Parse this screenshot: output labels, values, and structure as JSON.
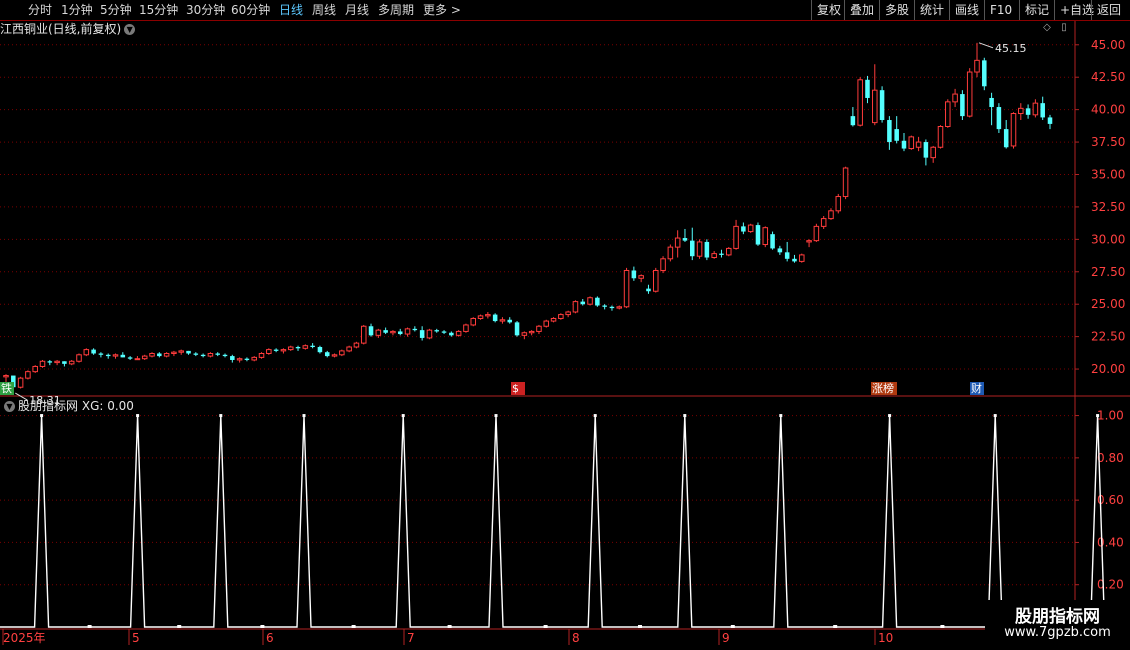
{
  "toolbar": {
    "periods": [
      "分时",
      "1分钟",
      "5分钟",
      "15分钟",
      "30分钟",
      "60分钟",
      "日线",
      "周线",
      "月线",
      "多周期",
      "更多 >"
    ],
    "active_period": "日线",
    "right_buttons": [
      "复权",
      "叠加",
      "多股",
      "统计",
      "画线",
      "F10",
      "标记",
      "+自选",
      "返回"
    ]
  },
  "header": {
    "title": "江西铜业(日线,前复权)"
  },
  "indicator": {
    "title": "股朋指标网",
    "label": "XG: 0.00"
  },
  "watermark": {
    "title": "股朋指标网",
    "url": "www.7gpzb.com"
  },
  "colors": {
    "up": "#ff3c3c",
    "down": "#54ffff",
    "grid": "#7a0000",
    "axis": "#b22222",
    "line": "#ffffff"
  },
  "chart_data": [
    {
      "type": "candlestick",
      "title": "江西铜业(日线,前复权)",
      "yticks": [
        "45.00",
        "42.50",
        "40.00",
        "37.50",
        "35.00",
        "32.50",
        "30.00",
        "27.50",
        "25.00",
        "22.50",
        "20.00"
      ],
      "ylim": [
        18.0,
        45.6
      ],
      "grid": true,
      "annotations": [
        {
          "text": "18.31",
          "kind": "low"
        },
        {
          "text": "45.15",
          "kind": "high"
        }
      ],
      "markers": [
        {
          "text": "铁",
          "position": "left"
        },
        {
          "text": "$",
          "position": "mid"
        },
        {
          "text": "涨榜",
          "position": "late"
        },
        {
          "text": "财",
          "position": "late"
        }
      ],
      "candles": [
        [
          19.4,
          19.6,
          19.0,
          19.5
        ],
        [
          19.5,
          19.4,
          18.3,
          18.6
        ],
        [
          18.6,
          19.4,
          18.5,
          19.3
        ],
        [
          19.3,
          19.9,
          19.2,
          19.8
        ],
        [
          19.8,
          20.3,
          19.7,
          20.2
        ],
        [
          20.2,
          20.7,
          20.1,
          20.6
        ],
        [
          20.6,
          20.7,
          20.3,
          20.5
        ],
        [
          20.5,
          20.7,
          20.3,
          20.6
        ],
        [
          20.6,
          20.6,
          20.2,
          20.4
        ],
        [
          20.4,
          20.7,
          20.3,
          20.6
        ],
        [
          20.6,
          21.2,
          20.5,
          21.1
        ],
        [
          21.1,
          21.6,
          21.0,
          21.5
        ],
        [
          21.5,
          21.6,
          21.1,
          21.2
        ],
        [
          21.2,
          21.3,
          20.9,
          21.1
        ],
        [
          21.1,
          21.2,
          20.8,
          21.0
        ],
        [
          21.0,
          21.2,
          20.8,
          21.1
        ],
        [
          21.1,
          21.3,
          20.9,
          20.9
        ],
        [
          20.9,
          21.0,
          20.7,
          20.8
        ],
        [
          20.8,
          21.0,
          20.7,
          20.8
        ],
        [
          20.8,
          21.1,
          20.7,
          21.0
        ],
        [
          21.0,
          21.3,
          20.9,
          21.2
        ],
        [
          21.2,
          21.3,
          20.9,
          21.0
        ],
        [
          21.0,
          21.3,
          20.9,
          21.2
        ],
        [
          21.2,
          21.4,
          21.0,
          21.3
        ],
        [
          21.3,
          21.5,
          21.1,
          21.4
        ],
        [
          21.4,
          21.4,
          21.1,
          21.2
        ],
        [
          21.2,
          21.3,
          21.0,
          21.1
        ],
        [
          21.1,
          21.2,
          20.9,
          21.0
        ],
        [
          21.0,
          21.3,
          20.9,
          21.2
        ],
        [
          21.2,
          21.3,
          21.0,
          21.1
        ],
        [
          21.1,
          21.2,
          20.9,
          21.0
        ],
        [
          21.0,
          21.1,
          20.5,
          20.7
        ],
        [
          20.7,
          20.9,
          20.5,
          20.8
        ],
        [
          20.8,
          20.9,
          20.6,
          20.7
        ],
        [
          20.7,
          21.0,
          20.6,
          20.9
        ],
        [
          20.9,
          21.3,
          20.8,
          21.2
        ],
        [
          21.2,
          21.6,
          21.1,
          21.5
        ],
        [
          21.5,
          21.6,
          21.3,
          21.4
        ],
        [
          21.4,
          21.6,
          21.2,
          21.5
        ],
        [
          21.5,
          21.8,
          21.4,
          21.7
        ],
        [
          21.7,
          21.8,
          21.4,
          21.6
        ],
        [
          21.6,
          21.9,
          21.5,
          21.8
        ],
        [
          21.8,
          22.0,
          21.6,
          21.7
        ],
        [
          21.7,
          21.8,
          21.2,
          21.3
        ],
        [
          21.3,
          21.4,
          20.9,
          21.0
        ],
        [
          21.0,
          21.2,
          20.9,
          21.1
        ],
        [
          21.1,
          21.5,
          21.0,
          21.4
        ],
        [
          21.4,
          21.8,
          21.3,
          21.7
        ],
        [
          21.7,
          22.1,
          21.6,
          22.0
        ],
        [
          22.0,
          23.4,
          21.9,
          23.3
        ],
        [
          23.3,
          23.5,
          22.5,
          22.6
        ],
        [
          22.6,
          23.1,
          22.4,
          23.0
        ],
        [
          23.0,
          23.2,
          22.7,
          22.8
        ],
        [
          22.8,
          23.0,
          22.6,
          22.9
        ],
        [
          22.9,
          23.1,
          22.6,
          22.7
        ],
        [
          22.7,
          23.2,
          22.5,
          23.1
        ],
        [
          23.1,
          23.3,
          22.9,
          23.0
        ],
        [
          23.0,
          23.3,
          22.2,
          22.4
        ],
        [
          22.4,
          23.1,
          22.3,
          23.0
        ],
        [
          23.0,
          23.1,
          22.8,
          22.9
        ],
        [
          22.9,
          23.0,
          22.7,
          22.8
        ],
        [
          22.8,
          22.9,
          22.5,
          22.6
        ],
        [
          22.6,
          23.0,
          22.5,
          22.9
        ],
        [
          22.9,
          23.5,
          22.8,
          23.4
        ],
        [
          23.4,
          24.0,
          23.3,
          23.9
        ],
        [
          23.9,
          24.2,
          23.8,
          24.1
        ],
        [
          24.1,
          24.4,
          23.9,
          24.2
        ],
        [
          24.2,
          24.3,
          23.6,
          23.7
        ],
        [
          23.7,
          24.0,
          23.5,
          23.8
        ],
        [
          23.8,
          24.0,
          23.5,
          23.6
        ],
        [
          23.6,
          23.7,
          22.5,
          22.6
        ],
        [
          22.6,
          22.9,
          22.3,
          22.8
        ],
        [
          22.8,
          23.0,
          22.6,
          22.9
        ],
        [
          22.9,
          23.4,
          22.7,
          23.3
        ],
        [
          23.3,
          23.8,
          23.2,
          23.7
        ],
        [
          23.7,
          24.0,
          23.6,
          23.9
        ],
        [
          23.9,
          24.3,
          23.8,
          24.2
        ],
        [
          24.2,
          24.5,
          24.0,
          24.4
        ],
        [
          24.4,
          25.3,
          24.3,
          25.2
        ],
        [
          25.2,
          25.4,
          24.9,
          25.0
        ],
        [
          25.0,
          25.6,
          24.9,
          25.5
        ],
        [
          25.5,
          25.6,
          24.8,
          24.9
        ],
        [
          24.9,
          25.0,
          24.6,
          24.8
        ],
        [
          24.8,
          24.9,
          24.5,
          24.7
        ],
        [
          24.7,
          24.9,
          24.6,
          24.8
        ],
        [
          24.8,
          27.8,
          24.7,
          27.6
        ],
        [
          27.6,
          27.9,
          26.8,
          27.0
        ],
        [
          27.0,
          27.3,
          26.7,
          27.2
        ],
        [
          26.2,
          26.5,
          25.8,
          26.0
        ],
        [
          26.0,
          27.8,
          25.9,
          27.6
        ],
        [
          27.6,
          28.7,
          27.4,
          28.5
        ],
        [
          28.5,
          29.6,
          28.3,
          29.4
        ],
        [
          29.4,
          30.7,
          28.6,
          30.1
        ],
        [
          30.1,
          30.8,
          29.8,
          29.9
        ],
        [
          29.9,
          30.9,
          28.4,
          28.7
        ],
        [
          28.7,
          30.0,
          28.5,
          29.8
        ],
        [
          29.8,
          30.0,
          28.4,
          28.6
        ],
        [
          28.6,
          29.1,
          28.5,
          28.9
        ],
        [
          28.9,
          29.2,
          28.6,
          28.8
        ],
        [
          28.8,
          29.4,
          28.7,
          29.3
        ],
        [
          29.3,
          31.5,
          29.2,
          31.0
        ],
        [
          31.0,
          31.3,
          30.4,
          30.6
        ],
        [
          30.6,
          31.2,
          30.5,
          31.1
        ],
        [
          31.1,
          31.3,
          29.5,
          29.6
        ],
        [
          29.6,
          31.0,
          29.4,
          30.9
        ],
        [
          30.4,
          30.6,
          29.2,
          29.3
        ],
        [
          29.3,
          29.5,
          28.8,
          29.0
        ],
        [
          29.0,
          29.8,
          28.3,
          28.5
        ],
        [
          28.5,
          28.8,
          28.2,
          28.3
        ],
        [
          28.3,
          28.9,
          28.2,
          28.8
        ],
        [
          29.8,
          30.0,
          29.4,
          29.9
        ],
        [
          29.9,
          31.2,
          29.8,
          31.0
        ],
        [
          31.0,
          31.8,
          30.8,
          31.6
        ],
        [
          31.6,
          32.4,
          31.5,
          32.2
        ],
        [
          32.2,
          33.5,
          32.0,
          33.3
        ],
        [
          33.3,
          35.6,
          33.1,
          35.5
        ],
        [
          39.5,
          40.2,
          38.7,
          38.8
        ],
        [
          38.8,
          42.5,
          38.7,
          42.3
        ],
        [
          42.3,
          42.6,
          40.5,
          40.9
        ],
        [
          39.0,
          43.5,
          38.8,
          41.5
        ],
        [
          41.5,
          41.8,
          39.0,
          39.2
        ],
        [
          39.2,
          39.5,
          36.9,
          37.5
        ],
        [
          38.5,
          39.5,
          37.4,
          37.6
        ],
        [
          37.6,
          38.2,
          36.8,
          37.0
        ],
        [
          37.0,
          38.0,
          36.9,
          37.9
        ],
        [
          37.1,
          37.9,
          36.8,
          37.5
        ],
        [
          37.5,
          37.7,
          35.7,
          36.3
        ],
        [
          36.3,
          37.2,
          35.9,
          37.1
        ],
        [
          37.1,
          38.8,
          37.0,
          38.7
        ],
        [
          38.7,
          40.8,
          38.6,
          40.6
        ],
        [
          40.6,
          41.6,
          40.2,
          41.2
        ],
        [
          41.2,
          41.5,
          39.2,
          39.5
        ],
        [
          39.5,
          43.2,
          39.4,
          42.9
        ],
        [
          42.9,
          45.15,
          42.5,
          43.8
        ],
        [
          43.8,
          44.0,
          41.5,
          41.8
        ],
        [
          40.9,
          41.3,
          38.8,
          40.2
        ],
        [
          40.2,
          40.5,
          38.2,
          38.5
        ],
        [
          38.5,
          39.2,
          37.0,
          37.1
        ],
        [
          37.2,
          39.8,
          37.0,
          39.7
        ],
        [
          39.7,
          40.5,
          39.2,
          40.1
        ],
        [
          40.1,
          40.4,
          39.3,
          39.6
        ],
        [
          39.6,
          40.8,
          39.4,
          40.5
        ],
        [
          40.5,
          41.0,
          39.2,
          39.4
        ],
        [
          39.4,
          39.6,
          38.5,
          38.9
        ]
      ]
    },
    {
      "type": "line",
      "title": "股朋指标网",
      "yticks": [
        "1.00",
        "0.80",
        "0.60",
        "0.40",
        "0.20"
      ],
      "ylim": [
        0,
        1.05
      ],
      "grid": true,
      "x_labels": [
        "2025年",
        "5",
        "6",
        "7",
        "8",
        "9",
        "10"
      ],
      "peaks": [
        0.13,
        0.43,
        0.69,
        0.95,
        1.26,
        1.55,
        1.86,
        2.14,
        2.44,
        2.78,
        3.11,
        3.43
      ],
      "series": [
        {
          "name": "XG",
          "note": "spikes to 1.00 at regular intervals"
        }
      ]
    }
  ]
}
